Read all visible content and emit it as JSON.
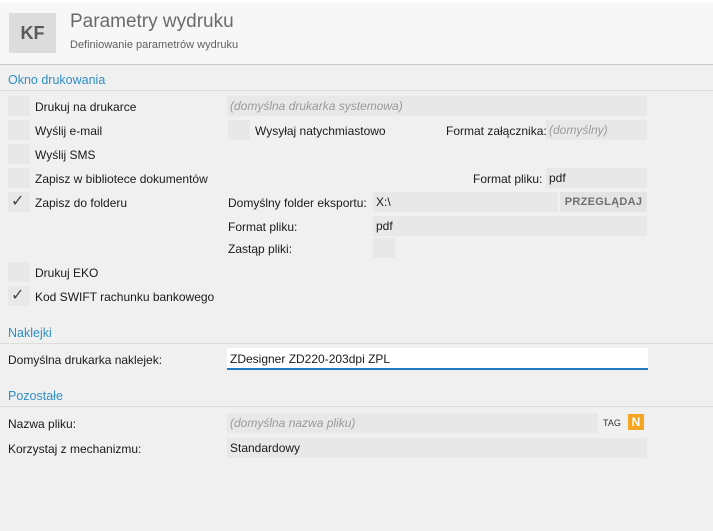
{
  "header": {
    "logo": "KF",
    "title": "Parametry wydruku",
    "subtitle": "Definiowanie parametrów wydruku"
  },
  "sections": {
    "print_window": "Okno drukowania",
    "stickers": "Naklejki",
    "other": "Pozostałe"
  },
  "print": {
    "print_on_printer": {
      "label": "Drukuj na drukarce",
      "checked": false,
      "printer_placeholder": "(domyślna drukarka systemowa)"
    },
    "send_email": {
      "label": "Wyślij e-mail",
      "checked": false,
      "send_now_label": "Wysyłaj natychmiastowo",
      "send_now_checked": false,
      "attachment_format_label": "Format załącznika:",
      "attachment_format_placeholder": "(domyślny)"
    },
    "send_sms": {
      "label": "Wyślij SMS",
      "checked": false
    },
    "save_library": {
      "label": "Zapisz w bibliotece dokumentów",
      "checked": false,
      "file_format_label": "Format pliku:",
      "file_format_value": "pdf"
    },
    "save_folder": {
      "label": "Zapisz do folderu",
      "checked": true,
      "export_folder_label": "Domyślny folder eksportu:",
      "export_folder_value": "X:\\",
      "browse_label": "PRZEGLĄDAJ",
      "file_format_label": "Format pliku:",
      "file_format_value": "pdf",
      "replace_files_label": "Zastąp pliki:",
      "replace_files_checked": false
    },
    "print_eko": {
      "label": "Drukuj EKO",
      "checked": false
    },
    "swift_code": {
      "label": "Kod SWIFT rachunku bankowego",
      "checked": true
    }
  },
  "stickers": {
    "default_printer_label": "Domyślna drukarka naklejek:",
    "default_printer_value": "ZDesigner ZD220-203dpi ZPL"
  },
  "other": {
    "file_name_label": "Nazwa pliku:",
    "file_name_placeholder": "(domyślna nazwa pliku)",
    "tag_label": "TAG",
    "n_icon_label": "N",
    "mechanism_label": "Korzystaj z mechanizmu:",
    "mechanism_value": "Standardowy"
  },
  "colors": {
    "accent": "#2f8fc4",
    "active_underline": "#1f7ac2",
    "n_icon": "#f5a623",
    "background": "#f0f0f0"
  }
}
